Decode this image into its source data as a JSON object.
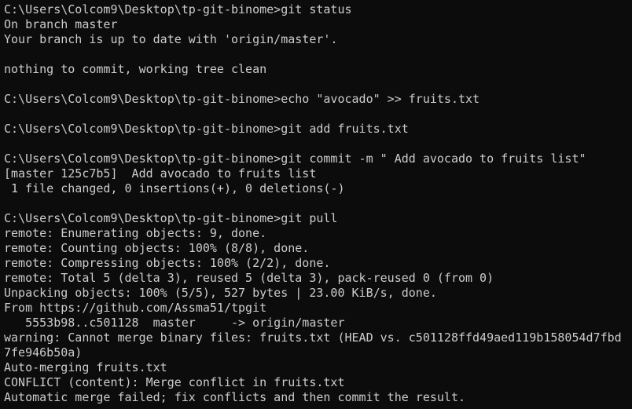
{
  "terminal": {
    "lines": [
      "C:\\Users\\Colcom9\\Desktop\\tp-git-binome>git status",
      "On branch master",
      "Your branch is up to date with 'origin/master'.",
      "",
      "nothing to commit, working tree clean",
      "",
      "C:\\Users\\Colcom9\\Desktop\\tp-git-binome>echo \"avocado\" >> fruits.txt",
      "",
      "C:\\Users\\Colcom9\\Desktop\\tp-git-binome>git add fruits.txt",
      "",
      "C:\\Users\\Colcom9\\Desktop\\tp-git-binome>git commit -m \" Add avocado to fruits list\"",
      "[master 125c7b5]  Add avocado to fruits list",
      " 1 file changed, 0 insertions(+), 0 deletions(-)",
      "",
      "C:\\Users\\Colcom9\\Desktop\\tp-git-binome>git pull",
      "remote: Enumerating objects: 9, done.",
      "remote: Counting objects: 100% (8/8), done.",
      "remote: Compressing objects: 100% (2/2), done.",
      "remote: Total 5 (delta 3), reused 5 (delta 3), pack-reused 0 (from 0)",
      "Unpacking objects: 100% (5/5), 527 bytes | 23.00 KiB/s, done.",
      "From https://github.com/Assma51/tpgit",
      "   5553b98..c501128  master     -> origin/master",
      "warning: Cannot merge binary files: fruits.txt (HEAD vs. c501128ffd49aed119b158054d7fbd",
      "7fe946b50a)",
      "Auto-merging fruits.txt",
      "CONFLICT (content): Merge conflict in fruits.txt",
      "Automatic merge failed; fix conflicts and then commit the result."
    ]
  }
}
